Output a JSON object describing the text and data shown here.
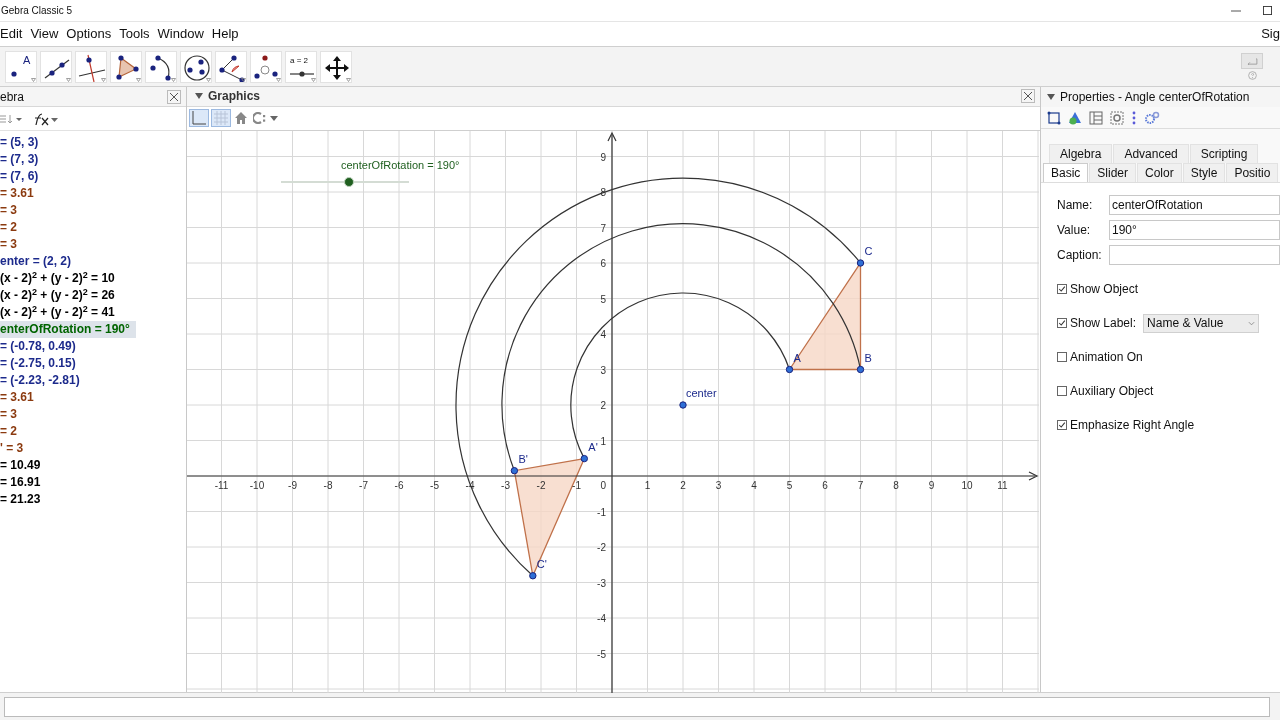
{
  "window": {
    "title": "Gebra Classic 5"
  },
  "menu": [
    "Edit",
    "View",
    "Options",
    "Tools",
    "Window",
    "Help"
  ],
  "account": "Sig",
  "toolbar": {
    "tools": [
      {
        "kind": "point",
        "label": "A"
      },
      {
        "kind": "line"
      },
      {
        "kind": "perpendicular"
      },
      {
        "kind": "polygon"
      },
      {
        "kind": "arc"
      },
      {
        "kind": "circle"
      },
      {
        "kind": "angle"
      },
      {
        "kind": "reflect"
      },
      {
        "kind": "slider",
        "label": "a = 2"
      },
      {
        "kind": "move"
      }
    ]
  },
  "algebra": {
    "title": "ebra",
    "rows": [
      {
        "text": "= (5, 3)",
        "color": "#1c2a8c",
        "selected": false
      },
      {
        "text": "= (7, 3)",
        "color": "#1c2a8c",
        "selected": false
      },
      {
        "text": "= (7, 6)",
        "color": "#1c2a8c",
        "selected": false
      },
      {
        "text": "= 3.61",
        "color": "#8b3a0f",
        "selected": false
      },
      {
        "text": "= 3",
        "color": "#8b3a0f",
        "selected": false
      },
      {
        "text": "= 2",
        "color": "#8b3a0f",
        "selected": false
      },
      {
        "text": "= 3",
        "color": "#8b3a0f",
        "selected": false
      },
      {
        "text": "enter = (2, 2)",
        "color": "#1c2a8c",
        "selected": false
      },
      {
        "text": "(x - 2)$^{2}$ + (y - 2)$^{2}$ = 10",
        "color": "#000000",
        "selected": false
      },
      {
        "text": "(x - 2)$^{2}$ + (y - 2)$^{2}$ = 26",
        "color": "#000000",
        "selected": false
      },
      {
        "text": "(x - 2)$^{2}$ + (y - 2)$^{2}$ = 41",
        "color": "#000000",
        "selected": false
      },
      {
        "text": "enterOfRotation = 190°",
        "color": "#006400",
        "selected": true
      },
      {
        "text": "= (-0.78, 0.49)",
        "color": "#1c2a8c",
        "selected": false
      },
      {
        "text": "= (-2.75, 0.15)",
        "color": "#1c2a8c",
        "selected": false
      },
      {
        "text": "= (-2.23, -2.81)",
        "color": "#1c2a8c",
        "selected": false
      },
      {
        "text": "= 3.61",
        "color": "#8b3a0f",
        "selected": false
      },
      {
        "text": "= 3",
        "color": "#8b3a0f",
        "selected": false
      },
      {
        "text": "= 2",
        "color": "#8b3a0f",
        "selected": false
      },
      {
        "text": "' = 3",
        "color": "#8b3a0f",
        "selected": false
      },
      {
        "text": "= 10.49",
        "color": "#000000",
        "selected": false
      },
      {
        "text": "= 16.91",
        "color": "#000000",
        "selected": false
      },
      {
        "text": "= 21.23",
        "color": "#000000",
        "selected": false
      }
    ]
  },
  "graphics": {
    "title": "Graphics",
    "style_bar": {
      "axes": true,
      "grid": true
    },
    "slider": {
      "label": "centerOfRotation = 190°",
      "level": 0.53
    },
    "x_tick_labels": [
      "-11",
      "-10",
      "-9",
      "-8",
      "-7",
      "-6",
      "-5",
      "-4",
      "-3",
      "-2",
      "-1",
      "1",
      "2",
      "3",
      "4",
      "5",
      "6",
      "7",
      "8",
      "9",
      "10",
      "11"
    ],
    "y_tick_labels": [
      "9",
      "8",
      "7",
      "6",
      "5",
      "4",
      "3",
      "2",
      "1",
      "-1",
      "-2",
      "-3",
      "-4",
      "-5"
    ],
    "origin_label": "0",
    "points": [
      {
        "label": "A"
      },
      {
        "label": "B"
      },
      {
        "label": "C"
      },
      {
        "label": "center"
      },
      {
        "label": "A'"
      },
      {
        "label": "B'"
      },
      {
        "label": "C'"
      }
    ]
  },
  "properties": {
    "title": "Properties - Angle centerOfRotation",
    "tab_rows": [
      {
        "tabs": [
          {
            "label": "Algebra",
            "selected": false
          },
          {
            "label": "Advanced",
            "selected": false
          },
          {
            "label": "Scripting",
            "selected": false
          }
        ]
      },
      {
        "tabs": [
          {
            "label": "Basic",
            "selected": true
          },
          {
            "label": "Slider",
            "selected": false
          },
          {
            "label": "Color",
            "selected": false
          },
          {
            "label": "Style",
            "selected": false
          },
          {
            "label": "Positio",
            "selected": false
          }
        ]
      }
    ],
    "fields": [
      {
        "label": "Name:",
        "value": "centerOfRotation"
      },
      {
        "label": "Value:",
        "value": "190°"
      },
      {
        "label": "Caption:"
      }
    ],
    "options": [
      {
        "label": "Show Object",
        "checked": true
      },
      {
        "label": "Show Label:",
        "checked": true,
        "select": "Name & Value"
      },
      {
        "label": "Animation On",
        "checked": false
      },
      {
        "label": "Auxiliary Object",
        "checked": false
      },
      {
        "label": "Emphasize Right Angle",
        "checked": true
      }
    ]
  }
}
